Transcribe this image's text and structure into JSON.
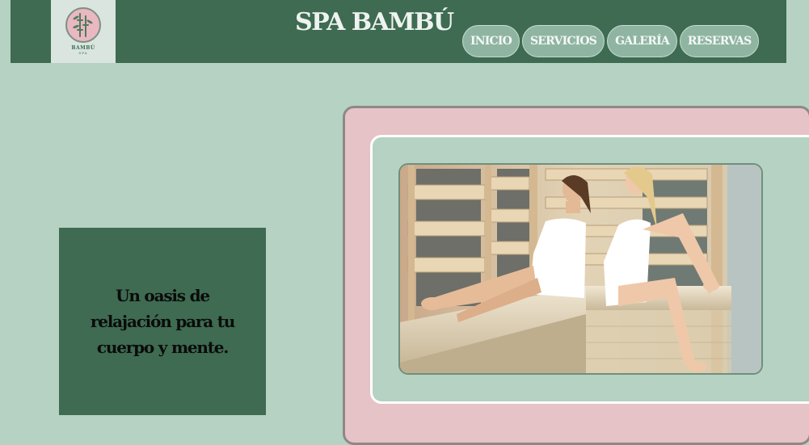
{
  "header": {
    "site_title": "SPA BAMBÚ",
    "logo": {
      "name": "BAMBÚ",
      "sub": "SPA"
    },
    "nav": [
      {
        "label": "INICIO"
      },
      {
        "label": "SERVICIOS"
      },
      {
        "label": "GALERÍA"
      },
      {
        "label": "RESERVAS"
      }
    ]
  },
  "hero": {
    "tagline": "Un oasis de relajación para tu cuerpo y mente.",
    "image": {
      "description_icon": "sauna-photo"
    }
  },
  "colors": {
    "background": "#b6d2c2",
    "header": "#3e6b51",
    "nav_button": "#8fb5a2",
    "frame_pink": "#e5c3c6",
    "tagline_box": "#3e6b51"
  }
}
